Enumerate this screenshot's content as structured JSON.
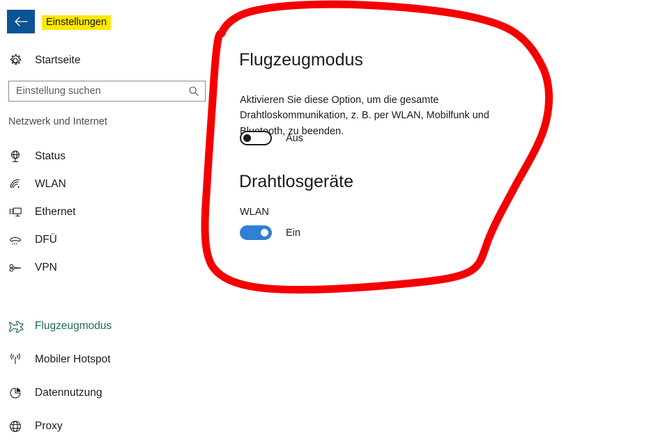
{
  "window": {
    "title": "Einstellungen",
    "back_icon": "arrow-left-icon",
    "accent_blue": "#0b5394",
    "highlighter_yellow": "#ffe800",
    "annotation_red": "#f50000"
  },
  "sidebar": {
    "home": {
      "label": "Startseite",
      "icon": "gear-icon"
    },
    "search": {
      "placeholder": "Einstellung suchen",
      "value": "",
      "icon": "search-icon"
    },
    "section_heading": "Netzwerk und Internet",
    "items": [
      {
        "label": "Status",
        "icon": "network-status-icon",
        "selected": false,
        "highlighted": false
      },
      {
        "label": "WLAN",
        "icon": "wifi-icon",
        "selected": false,
        "highlighted": false
      },
      {
        "label": "Ethernet",
        "icon": "ethernet-icon",
        "selected": false,
        "highlighted": false
      },
      {
        "label": "DFÜ",
        "icon": "dialup-phone-icon",
        "selected": false,
        "highlighted": false
      },
      {
        "label": "VPN",
        "icon": "vpn-key-icon",
        "selected": false,
        "highlighted": false
      },
      {
        "label": "Flugzeugmodus",
        "icon": "airplane-icon",
        "selected": true,
        "highlighted": true
      },
      {
        "label": "Mobiler Hotspot",
        "icon": "hotspot-broadcast-icon",
        "selected": false,
        "highlighted": false
      },
      {
        "label": "Datennutzung",
        "icon": "pie-chart-icon",
        "selected": false,
        "highlighted": false
      },
      {
        "label": "Proxy",
        "icon": "globe-icon",
        "selected": false,
        "highlighted": false
      }
    ]
  },
  "main": {
    "airplane": {
      "heading": "Flugzeugmodus",
      "description": "Aktivieren Sie diese Option, um die gesamte Drahtloskommunikation, z. B. per WLAN, Mobilfunk und Bluetooth, zu beenden.",
      "toggle_state": "Aus",
      "toggle_on": false
    },
    "wireless": {
      "heading": "Drahtlosgeräte",
      "device_label": "WLAN",
      "toggle_state": "Ein",
      "toggle_on": true
    }
  },
  "annotations": {
    "circle": {
      "shape": "hand-drawn-ellipse",
      "color": "#f50000",
      "stroke_width": 11
    },
    "marker_title": {
      "target": "Einstellungen",
      "color": "#ffe800"
    },
    "marker_nav": {
      "target": "Flugzeugmodus",
      "color": "#ffe800"
    }
  }
}
